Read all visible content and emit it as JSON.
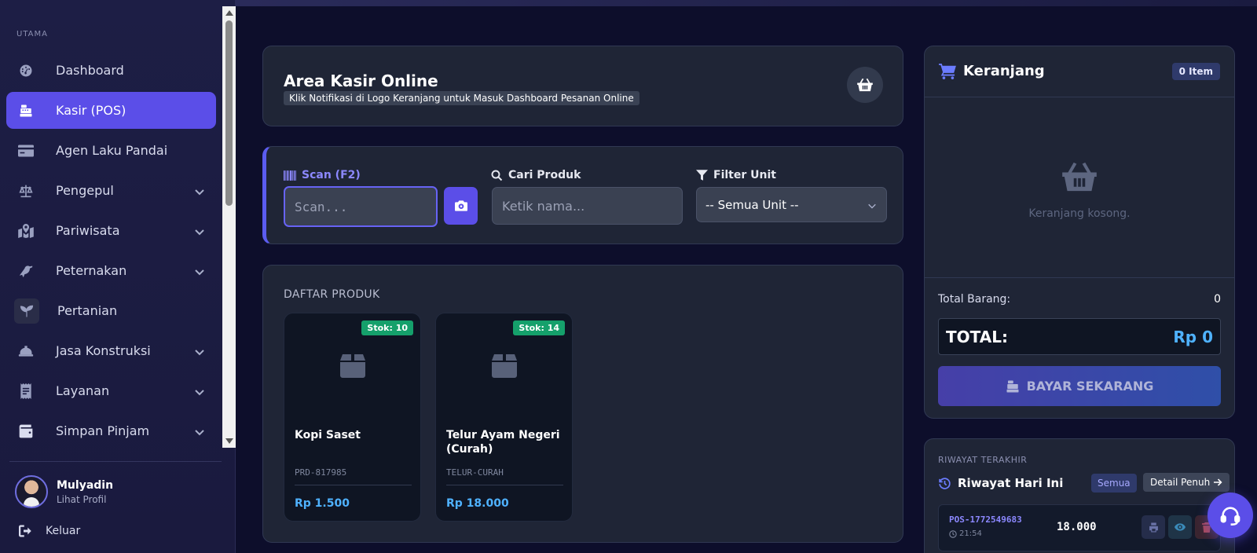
{
  "sidebar": {
    "section_label": "UTAMA",
    "items": [
      {
        "label": "Dashboard",
        "icon": "dashboard-icon",
        "active": false,
        "has_submenu": false
      },
      {
        "label": "Kasir (POS)",
        "icon": "cash-register-icon",
        "active": true,
        "has_submenu": false
      },
      {
        "label": "Agen Laku Pandai",
        "icon": "card-icon",
        "active": false,
        "has_submenu": false
      },
      {
        "label": "Pengepul",
        "icon": "scale-icon",
        "active": false,
        "has_submenu": true
      },
      {
        "label": "Pariwisata",
        "icon": "map-icon",
        "active": false,
        "has_submenu": true
      },
      {
        "label": "Peternakan",
        "icon": "bird-icon",
        "active": false,
        "has_submenu": true
      },
      {
        "label": "Pertanian",
        "icon": "seedling-icon",
        "active": false,
        "has_submenu": false
      },
      {
        "label": "Jasa Konstruksi",
        "icon": "hardhat-icon",
        "active": false,
        "has_submenu": true
      },
      {
        "label": "Layanan",
        "icon": "receipt-icon",
        "active": false,
        "has_submenu": true
      },
      {
        "label": "Simpan Pinjam",
        "icon": "wallet-icon",
        "active": false,
        "has_submenu": true
      }
    ],
    "profile": {
      "name": "Mulyadin",
      "link": "Lihat Profil"
    },
    "logout_label": "Keluar"
  },
  "header": {
    "title": "Area Kasir Online",
    "subtitle": "Klik Notifikasi di Logo Keranjang untuk Masuk Dashboard Pesanan Online"
  },
  "scan_panel": {
    "scan_label": "Scan (F2)",
    "scan_placeholder": "Scan...",
    "search_label": "Cari Produk",
    "search_placeholder": "Ketik nama...",
    "filter_label": "Filter Unit",
    "filter_value": "-- Semua Unit --"
  },
  "products": {
    "heading": "DAFTAR PRODUK",
    "items": [
      {
        "name": "Kopi Saset",
        "code": "PRD-817985",
        "price": "Rp 1.500",
        "stock": "Stok: 10"
      },
      {
        "name": "Telur Ayam Negeri (Curah)",
        "code": "TELUR-CURAH",
        "price": "Rp 18.000",
        "stock": "Stok: 14"
      }
    ]
  },
  "cart": {
    "title": "Keranjang",
    "items_badge": "0 Item",
    "empty_text": "Keranjang kosong.",
    "total_items_label": "Total Barang:",
    "total_items_value": "0",
    "total_label": "TOTAL:",
    "total_value": "Rp 0",
    "pay_label": "BAYAR SEKARANG"
  },
  "history": {
    "label": "RIWAYAT TERAKHIR",
    "title": "Riwayat Hari Ini",
    "all_button": "Semua",
    "detail_button": "Detail Penuh",
    "transactions": [
      {
        "id": "POS-1772549683",
        "time": "21:54",
        "amount": "18.000"
      }
    ]
  },
  "colors": {
    "accent": "#5b4ee8",
    "price": "#4fb2ff",
    "stock_badge": "#15a06b",
    "card_bg": "#1f2536",
    "page_bg": "#0d0e2b"
  }
}
